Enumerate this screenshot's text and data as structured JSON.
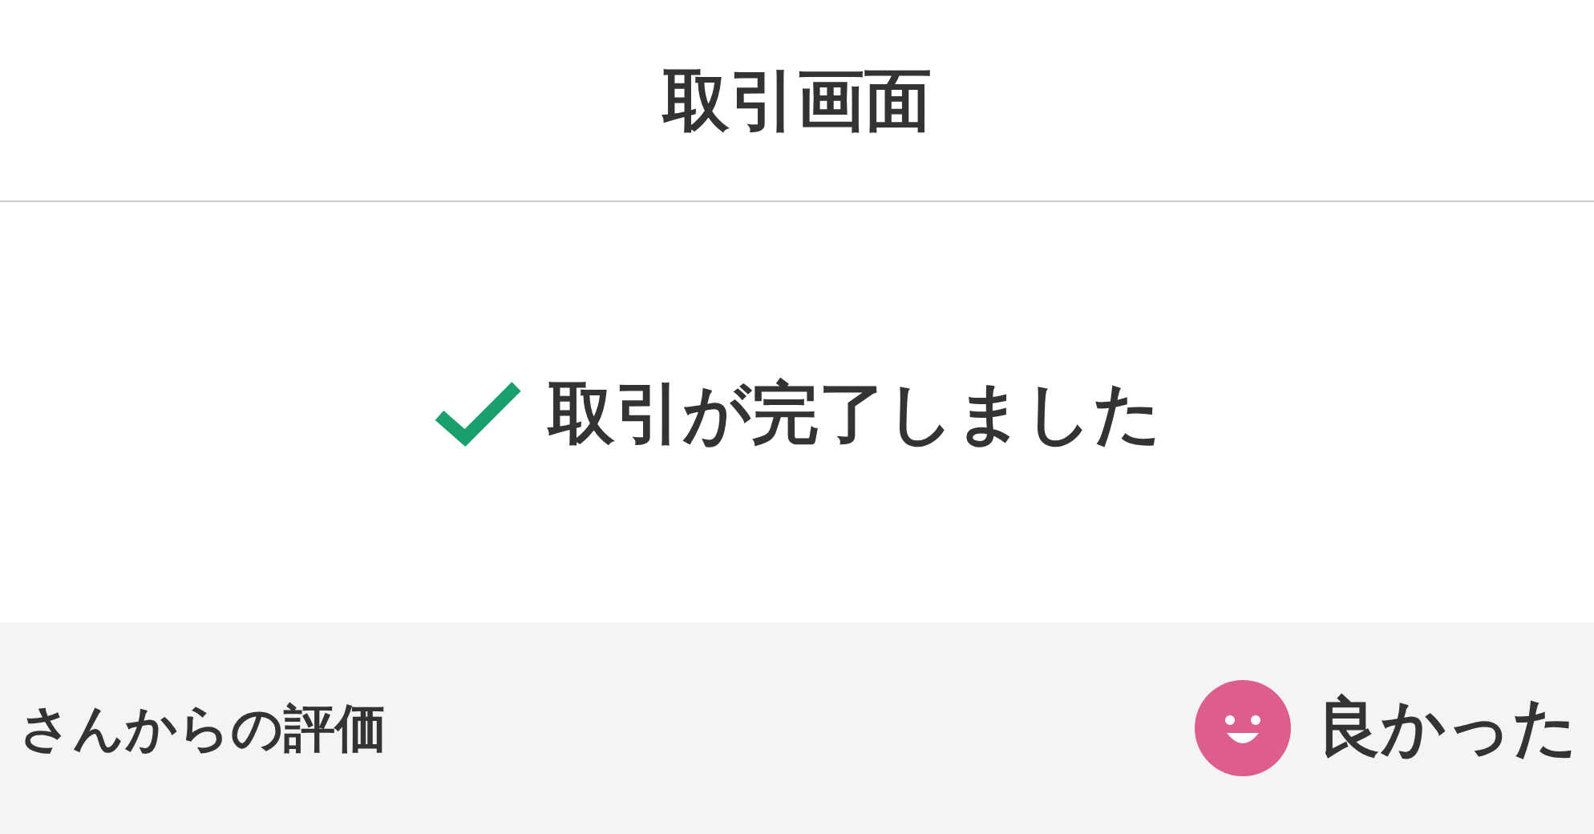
{
  "header": {
    "title": "取引画面"
  },
  "status": {
    "message": "取引が完了しました",
    "completed": true
  },
  "review": {
    "label": "さんからの評価",
    "rating": "良かった",
    "kind": "good"
  }
}
